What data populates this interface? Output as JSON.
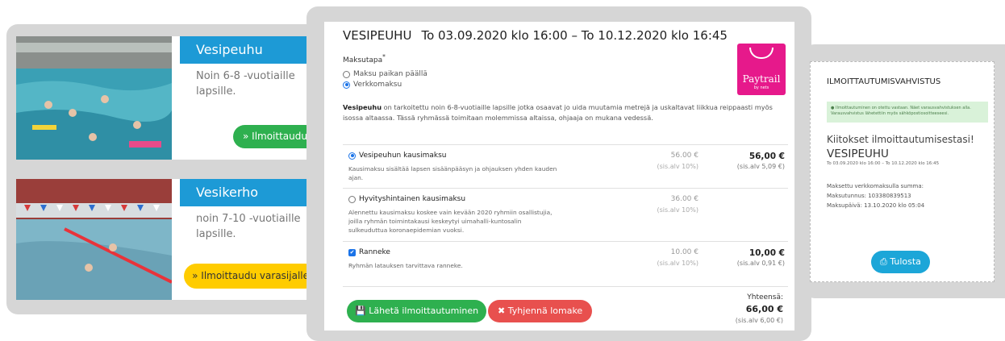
{
  "left": {
    "cards": [
      {
        "title": "Vesipeuhu",
        "description": "Noin 6-8 -vuotiaille lapsille.",
        "button": "» Ilmoittaudu",
        "photo_icon": "swimming-pool-photo"
      },
      {
        "title": "Vesikerho",
        "description": "noin 7-10 -vuotiaille lapsille.",
        "button": "» Ilmoittaudu varasijalle",
        "photo_icon": "swimming-pool-photo"
      }
    ]
  },
  "form": {
    "event_name": "VESIPEUHU",
    "event_dates": "To 03.09.2020 klo 16:00 – To 10.12.2020 klo 16:45",
    "payment_method_label": "Maksutapa",
    "payment_options": [
      {
        "label": "Maksu paikan päällä",
        "selected": false
      },
      {
        "label": "Verkkomaksu",
        "selected": true
      }
    ],
    "paytrail": {
      "name": "Paytrail",
      "sub": "by nets"
    },
    "intro_bold": "Vesipeuhu",
    "intro_text": " on tarkoitettu noin 6-8-vuotiaille lapsille jotka osaavat jo uida muutamia metrejä ja uskaltavat liikkua reippaasti myös isossa altaassa. Tässä ryhmässä toimitaan molemmissa altaissa, ohjaaja on mukana vedessä.",
    "prices": [
      {
        "name": "Vesipeuhun kausimaksu",
        "control": "radio-on",
        "description": "Kausimaksu sisältää lapsen sisäänpääsyn ja ohjauksen yhden kauden ajan.",
        "unit_price": "56.00 €",
        "unit_vat": "(sis.alv 10%)",
        "total": "56,00 €",
        "total_vat": "(sis.alv 5,09 €)"
      },
      {
        "name": "Hyvityshintainen kausimaksu",
        "control": "radio-off",
        "description": "Alennettu kausimaksu koskee vain kevään 2020 ryhmiin osallistujia, joilla ryhmän toimintakausi keskeytyi uimahalli-kuntosalin sulkeuduttua koronaepidemian vuoksi.",
        "unit_price": "36.00 €",
        "unit_vat": "(sis.alv 10%)",
        "total": "",
        "total_vat": ""
      },
      {
        "name": "Ranneke",
        "control": "checkbox-on",
        "description": "Ryhmän latauksen tarvittava ranneke.",
        "unit_price": "10.00 €",
        "unit_vat": "(sis.alv 10%)",
        "total": "10,00 €",
        "total_vat": "(sis.alv 0,91 €)"
      }
    ],
    "submit_button": "Lähetä ilmoittautuminen",
    "clear_button": "Tyhjennä lomake",
    "sum_label": "Yhteensä:",
    "sum_total": "66,00 €",
    "sum_vat": "(sis.alv 6,00 €)"
  },
  "confirmation": {
    "title": "ILMOITTAUTUMISVAHVISTUS",
    "alert": "Ilmoittautuminen on otettu vastaan. Näet varausvahvistuksen alla. Varausvahvistus lähetettiin myös sähköpostiosoitteeseesi.",
    "thanks": "Kiitokset ilmoittautumisestasi!",
    "event_name": "VESIPEUHU",
    "event_dates": "To 03.09.2020 klo 16:00 – To 10.12.2020 klo 16:45",
    "paid_label": "Maksettu verkkomaksulla summa:",
    "payment_id": "Maksutunnus: 103380839513",
    "payment_date": "Maksupäivä: 13.10.2020 klo 05:04",
    "print_button": "Tulosta"
  },
  "colors": {
    "blue_header": "#1d9ad6",
    "green": "#2eb04f",
    "yellow": "#ffcc00",
    "red": "#e8504e",
    "paytrail_pink": "#e6198b",
    "print_blue": "#1ca6d8"
  }
}
